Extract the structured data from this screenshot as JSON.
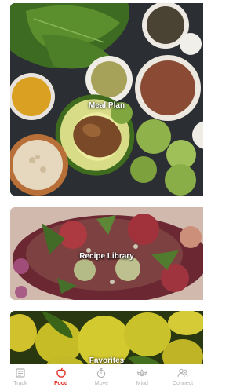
{
  "cards": [
    {
      "label": "Meal Plan"
    },
    {
      "label": "Recipe Library"
    },
    {
      "label": "Favorites"
    }
  ],
  "tabbar": {
    "active_color": "#e0261f",
    "inactive_color": "#b3b3b3",
    "items": [
      {
        "label": "Track",
        "icon": "track-icon",
        "active": false
      },
      {
        "label": "Food",
        "icon": "apple-icon",
        "active": true
      },
      {
        "label": "Move",
        "icon": "stopwatch-icon",
        "active": false
      },
      {
        "label": "Mind",
        "icon": "lotus-icon",
        "active": false
      },
      {
        "label": "Connect",
        "icon": "people-icon",
        "active": false
      }
    ]
  }
}
